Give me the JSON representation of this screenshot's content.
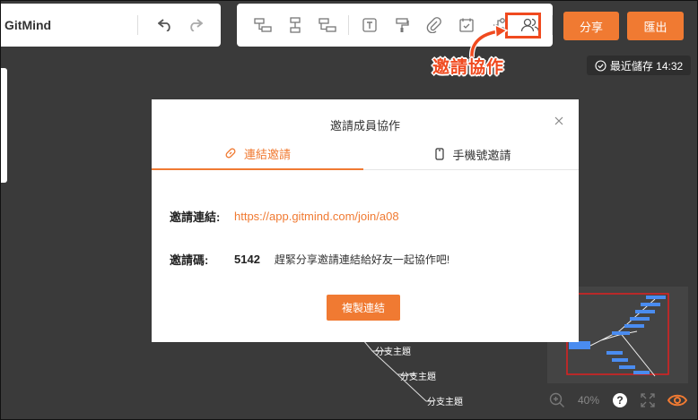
{
  "app": {
    "name": "GitMind"
  },
  "toolbar": {
    "share_label": "分享",
    "export_label": "匯出",
    "tools": [
      "sibling-topic-icon",
      "child-topic-icon",
      "subtopic-icon",
      "text-icon",
      "format-painter-icon",
      "attachment-icon",
      "calendar-icon",
      "relation-icon",
      "collaborate-icon"
    ]
  },
  "annotation": {
    "label": "邀請協作",
    "color": "#f04a1f"
  },
  "status": {
    "saved_text": "最近儲存 14:32"
  },
  "modal": {
    "title": "邀請成員協作",
    "tabs": [
      {
        "label": "連結邀請",
        "active": true
      },
      {
        "label": "手機號邀請",
        "active": false
      }
    ],
    "invite_link_label": "邀請連結:",
    "invite_link_value": "https://app.gitmind.com/join/a08",
    "invite_code_label": "邀請碼:",
    "invite_code_value": "5142",
    "hint": "趕緊分享邀請連結給好友一起協作吧!",
    "copy_button": "複製連結"
  },
  "canvas": {
    "branches": [
      "分支主題",
      "分支主題",
      "分支主題"
    ]
  },
  "zoom": {
    "level": "40%"
  },
  "colors": {
    "accent": "#f07a32",
    "annotation": "#f04a1f",
    "minimap_node": "#4a8cf0"
  }
}
